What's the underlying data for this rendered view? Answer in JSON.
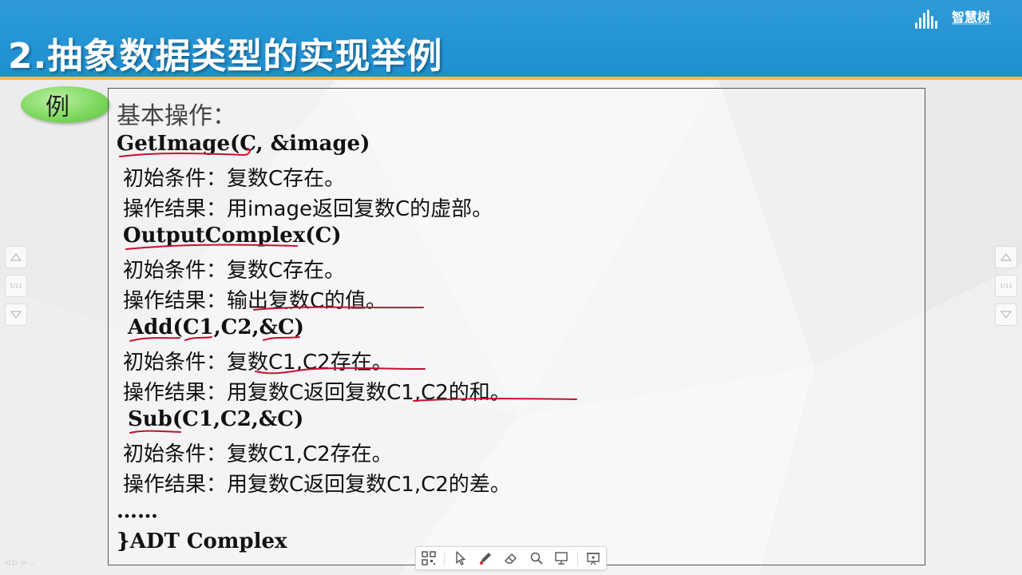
{
  "header": {
    "title": "2.抽象数据类型的实现举例",
    "logo_text": "智慧树",
    "logo_url": "www.zhihuishu.com"
  },
  "example_label": "例",
  "content": {
    "heading": "基本操作：",
    "lines": [
      "GetImage(C, &image)",
      "初始条件：复数C存在。",
      "操作结果：用image返回复数C的虚部。",
      "OutputComplex(C)",
      "初始条件：复数C存在。",
      "操作结果：输出复数C的值。",
      "Add(C1,C2,&C)",
      "初始条件：复数C1,C2存在。",
      "操作结果：用复数C返回复数C1,C2的和。",
      "Sub(C1,C2,&C)",
      "初始条件：复数C1,C2存在。",
      "操作结果：用复数C返回复数C1,C2的差。",
      "……",
      "}ADT Complex"
    ]
  },
  "side_nav": {
    "page_label": "1/11",
    "up_icon": "chevron-up-icon",
    "down_icon": "chevron-down-icon"
  },
  "toolbar": {
    "tools": [
      "qr-code-icon",
      "pointer-icon",
      "pen-icon",
      "eraser-icon",
      "search-icon",
      "screen-icon",
      "present-icon"
    ],
    "pen_color": "#d23b3b"
  },
  "colors": {
    "header_blue": "#1e8ed0",
    "stripe_yellow": "#f2c230",
    "annotation_red": "#c8102e",
    "pill_green": "#7fd85f"
  }
}
